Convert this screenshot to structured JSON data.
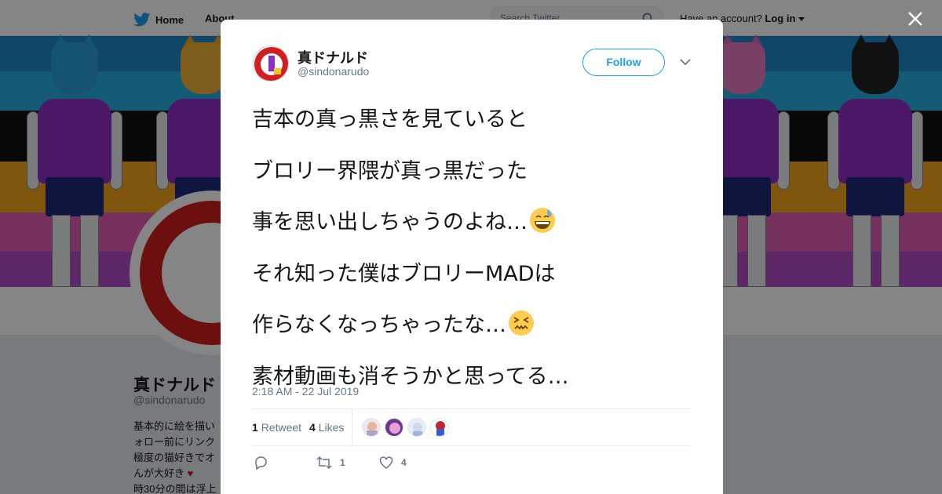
{
  "header": {
    "home_label": "Home",
    "about_label": "About",
    "search_placeholder": "Search Twitter",
    "account_prompt": "Have an account?",
    "login_label": "Log in"
  },
  "profile": {
    "name": "真ドナルド",
    "handle": "@sindonarudo",
    "bio_lines": [
      "基本的に絵を描い",
      "ォロー前にリンク",
      "極度の猫好きでオ",
      "んが大好き",
      "時30分の間は浮上"
    ]
  },
  "tweet": {
    "author_name": "真ドナルド",
    "author_handle": "@sindonarudo",
    "follow_label": "Follow",
    "lines": [
      {
        "text": "吉本の真っ黒さを見ていると",
        "emoji": ""
      },
      {
        "text": "ブロリー界隈が真っ黒だった",
        "emoji": ""
      },
      {
        "text": "事を思い出しちゃうのよね…",
        "emoji": "grinning-sweat-emoji"
      },
      {
        "text": "それ知った僕はブロリーMADは",
        "emoji": ""
      },
      {
        "text": "作らなくなっちゃったな…",
        "emoji": "confounded-face-emoji"
      },
      {
        "text": "素材動画も消そうかと思ってる…",
        "emoji": ""
      }
    ],
    "timestamp": "2:18 AM - 22 Jul 2019",
    "retweets_count": "1",
    "retweets_label": "Retweet",
    "likes_count": "4",
    "likes_label": "Likes",
    "actions": {
      "reply_count": "",
      "retweet_count": "1",
      "like_count": "4"
    }
  },
  "colors": {
    "accent": "#1da1f2",
    "text": "#14171a",
    "muted": "#657786"
  }
}
